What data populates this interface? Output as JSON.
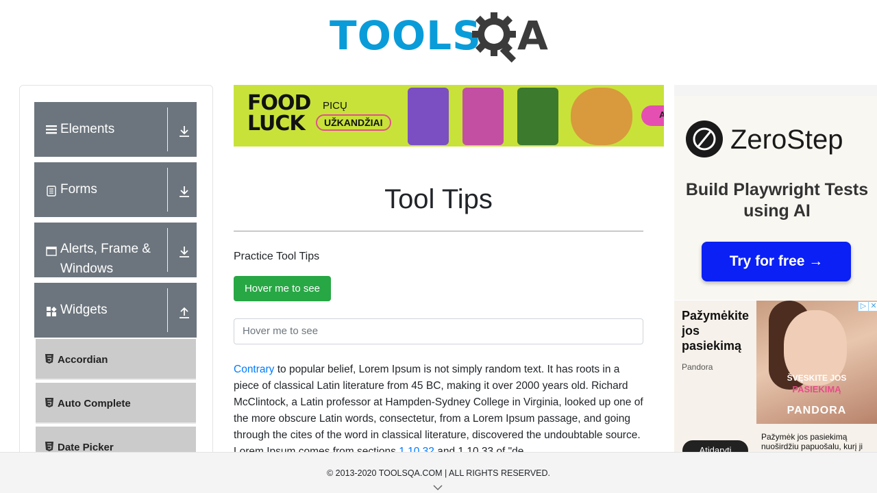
{
  "header": {
    "logo_word": "TOOLS",
    "logo_letter": "A",
    "logo_alt": "TOOLSQA"
  },
  "sidebar": {
    "groups": [
      {
        "label": "Elements",
        "icon": "hamburger-icon",
        "state": "collapsed"
      },
      {
        "label": "Forms",
        "icon": "form-icon",
        "state": "collapsed"
      },
      {
        "label": "Alerts, Frame &",
        "label2": "Windows",
        "icon": "window-icon",
        "state": "collapsed"
      },
      {
        "label": "Widgets",
        "icon": "widgets-icon",
        "state": "expanded"
      }
    ],
    "items": [
      {
        "label": "Accordian"
      },
      {
        "label": "Auto Complete"
      },
      {
        "label": "Date Picker"
      }
    ]
  },
  "banner": {
    "brand_line1": "FOOD",
    "brand_line2": "LUCK",
    "text1": "PICŲ",
    "text2": "UŽKANDŽIAI",
    "cta_fragment": "A"
  },
  "main": {
    "title": "Tool Tips",
    "practice_label": "Practice Tool Tips",
    "hover_button_label": "Hover me to see",
    "hover_input_placeholder": "Hover me to see",
    "paragraph_link": "Contrary",
    "paragraph_text": " to popular belief, Lorem Ipsum is not simply random text. It has roots in a piece of classical Latin literature from 45 BC, making it over 2000 years old. Richard McClintock, a Latin professor at Hampden-Sydney College in Virginia, looked up one of the more obscure Latin words, consectetur, from a Lorem Ipsum passage, and going through the cites of the word in classical literature, discovered the undoubtable source. Lorem Ipsum comes from sections ",
    "paragraph_link2": "1.10.32",
    "paragraph_text2": " and 1.10.33 of \"de"
  },
  "ads": {
    "zerostep": {
      "name": "ZeroStep",
      "tagline": "Build Playwright Tests using AI",
      "button": "Try for free →"
    },
    "pandora": {
      "headline": "Pažymėkite jos pasiekimą",
      "brand": "Pandora",
      "image_caption1": "ŠVĘSKITE JOS",
      "image_caption2": "PASIEKIMĄ",
      "image_caption3": "PANDORA",
      "description": "Pažymėk jos pasiekimą nuoširdžiu papuošalu, kurį ji",
      "cta": "Atidaryti"
    },
    "adchoices_icon": "play-icon",
    "close_icon": "close-icon"
  },
  "footer": {
    "copyright": "© 2013-2020 TOOLSQA.COM | ALL RIGHTS RESERVED."
  },
  "colors": {
    "brand_blue": "#0a9cd9",
    "sidebar_group": "#6c757d",
    "sidebar_item": "#cbcbcb",
    "success_button": "#28a745",
    "link": "#007bff",
    "zerostep_button": "#0a20f5"
  }
}
